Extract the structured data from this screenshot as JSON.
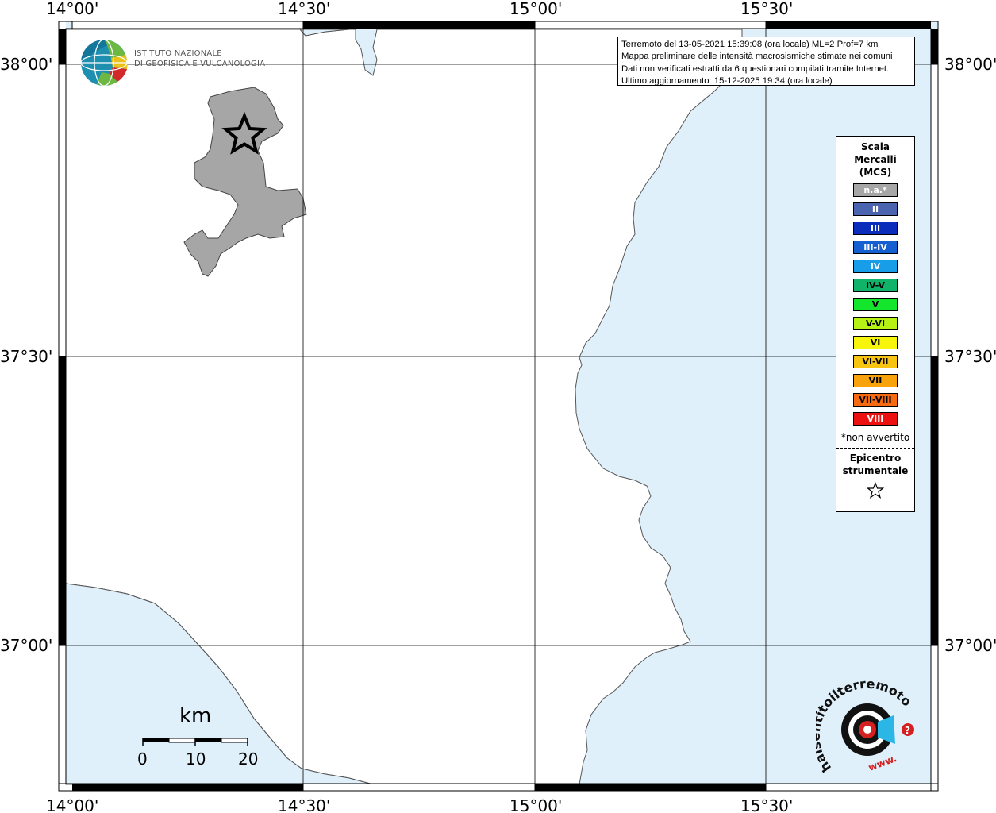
{
  "info": {
    "lines": [
      "Terremoto del 13-05-2021 15:39:08 (ora locale) ML=2 Prof=7 km",
      "Mappa preliminare delle intensità macrosismiche stimate nei comuni",
      "Dati non verificati estratti da 6 questionari compilati tramite Internet.",
      "Ultimo aggiornamento: 15-12-2025 19:34 (ora locale)"
    ]
  },
  "axes": {
    "lon_labels": [
      "14°00'",
      "14°30'",
      "15°00'",
      "15°30'"
    ],
    "lat_labels": [
      "38°00'",
      "37°30'",
      "37°00'"
    ]
  },
  "legend": {
    "title_lines": [
      "Scala",
      "Mercalli",
      "(MCS)"
    ],
    "items": [
      {
        "label": "n.a.*",
        "color": "#a6a6a6",
        "text_color": "#ffffff"
      },
      {
        "label": "II",
        "color": "#4a64b0",
        "text_color": "#ffffff"
      },
      {
        "label": "III",
        "color": "#0a2dbb",
        "text_color": "#ffffff"
      },
      {
        "label": "III-IV",
        "color": "#1560d0",
        "text_color": "#ffffff"
      },
      {
        "label": "IV",
        "color": "#189ee8",
        "text_color": "#ffffff"
      },
      {
        "label": "IV-V",
        "color": "#11b36a",
        "text_color": "#000000"
      },
      {
        "label": "V",
        "color": "#13e62c",
        "text_color": "#000000"
      },
      {
        "label": "V-VI",
        "color": "#b6f214",
        "text_color": "#000000"
      },
      {
        "label": "VI",
        "color": "#f7f50c",
        "text_color": "#000000"
      },
      {
        "label": "VI-VII",
        "color": "#f7c411",
        "text_color": "#000000"
      },
      {
        "label": "VII",
        "color": "#f8a30c",
        "text_color": "#000000"
      },
      {
        "label": "VII-VIII",
        "color": "#f76a0f",
        "text_color": "#000000"
      },
      {
        "label": "VIII",
        "color": "#ed1010",
        "text_color": "#ffffff"
      }
    ],
    "note": "*non avvertito",
    "epicenter_lines": [
      "Epicentro",
      "strumentale"
    ],
    "epicenter_symbol": "☆"
  },
  "logo_ingv": {
    "line1": "ISTITUTO NAZIONALE",
    "line2": "DI GEOFISICA E VULCANOLOGIA"
  },
  "scale_bar": {
    "unit": "km",
    "labels": [
      "0",
      "10",
      "20"
    ]
  },
  "logo_hst": {
    "text": "haisentitoilterremoto.it",
    "prefix": "www."
  },
  "colors": {
    "sea": "#dff0fb",
    "land": "#ffffff",
    "affected_area": "#a6a6a6",
    "grid": "#000000"
  }
}
